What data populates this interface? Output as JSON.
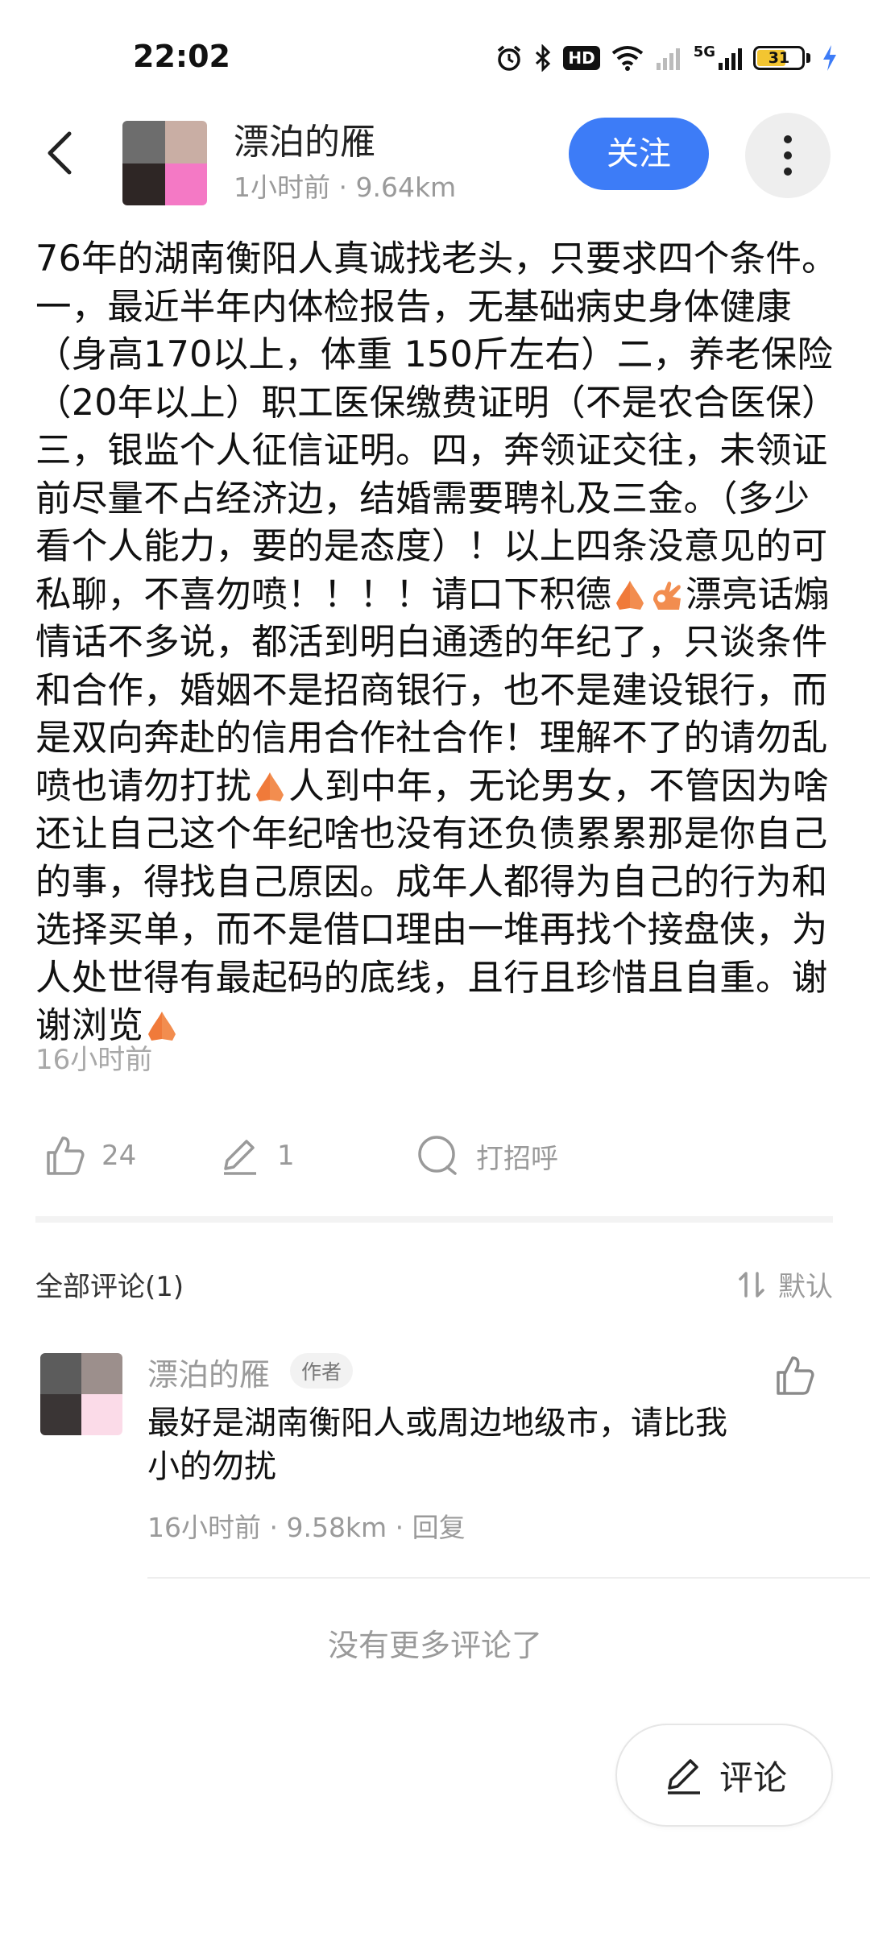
{
  "status_bar": {
    "time": "22:02",
    "icons": [
      "alarm-icon",
      "bluetooth-icon",
      "hd-icon",
      "wifi-icon",
      "signal-icon",
      "5g-signal-icon",
      "battery-icon",
      "charging-icon"
    ],
    "hd_label": "HD",
    "network_label": "5G",
    "battery_level": "31"
  },
  "header": {
    "user_name": "漂泊的雁",
    "meta": "1小时前 · 9.64km",
    "follow_label": "关注"
  },
  "post": {
    "text_before_1": "76年的湖南衡阳人真诚找老头，只要求四个条件。一，最近半年内体检报告，无基础病史身体健康（身高170以上，体重 150斤左右）二，养老保险（20年以上）职工医保缴费证明（不是农合医保）三，银监个人征信证明。四，奔领证交往，未领证前尽量不占经济边，结婚需要聘礼及三金。（多少看个人能力，要的是态度）！以上四条没意见的可私聊，不喜勿喷！！！！请口下积德",
    "text_before_2": "漂亮话煽情话不多说，都活到明白通透的年纪了，只谈条件和合作，婚姻不是招商银行，也不是建设银行，而是双向奔赴的信用合作社合作！理解不了的请勿乱喷也请勿打扰",
    "text_before_3": "人到中年，无论男女，不管因为啥还让自己这个年纪啥也没有还负债累累那是你自己的事，得找自己原因。成年人都得为自己的行为和选择买单，而不是借口理由一堆再找个接盘侠，为人处世得有最起码的底线，且行且珍惜且自重。谢谢浏览",
    "time": "16小时前"
  },
  "actions": {
    "like_count": "24",
    "comment_count": "1",
    "greet_label": "打招呼"
  },
  "comments": {
    "title": "全部评论(1)",
    "sort_label": "默认",
    "items": [
      {
        "name": "漂泊的雁",
        "badge": "作者",
        "text": "最好是湖南衡阳人或周边地级市，请比我小的勿扰",
        "meta": "16小时前 · 9.58km · 回复"
      }
    ],
    "no_more": "没有更多评论了"
  },
  "comment_button_label": "评论",
  "colors": {
    "accent": "#3d7cf7",
    "muted": "#9a9a9a",
    "emoji": "#f07a3a"
  }
}
